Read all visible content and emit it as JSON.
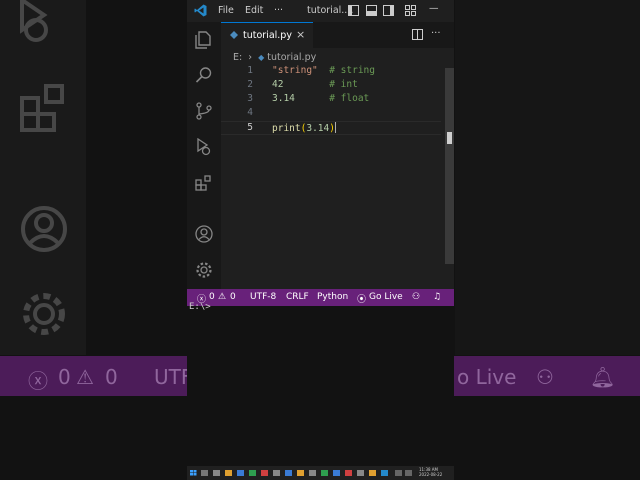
{
  "titlebar": {
    "menu_file": "File",
    "menu_edit": "Edit",
    "menu_more": "···",
    "title": "tutorial...."
  },
  "tab": {
    "filename": "tutorial.py",
    "close": "×"
  },
  "breadcrumb": {
    "root": "E:",
    "sep": "›",
    "file": "tutorial.py"
  },
  "code": {
    "lines": [
      {
        "num": "1",
        "code": "\"string\"",
        "comment": "# string"
      },
      {
        "num": "2",
        "code": "42",
        "comment": "# int"
      },
      {
        "num": "3",
        "code": "3.14",
        "comment": "# float"
      },
      {
        "num": "4",
        "code": "",
        "comment": ""
      },
      {
        "num": "5",
        "fn": "print",
        "open": "(",
        "arg": "3.14",
        "close": ")"
      }
    ]
  },
  "statusbar": {
    "errors": "0",
    "warnings": "0",
    "encoding": "UTF-8",
    "eol": "CRLF",
    "language": "Python",
    "golive": "Go Live"
  },
  "terminal": {
    "prompt": "E:\\>"
  },
  "background": {
    "errors": "0",
    "warnings": "0",
    "encoding": "UTF",
    "golive": "o Live"
  },
  "taskbar": {
    "clock_time": "11:38 AM",
    "clock_date": "2022-08-22"
  },
  "colors": {
    "statusbar": "#68217a",
    "accent": "#0078d4"
  }
}
